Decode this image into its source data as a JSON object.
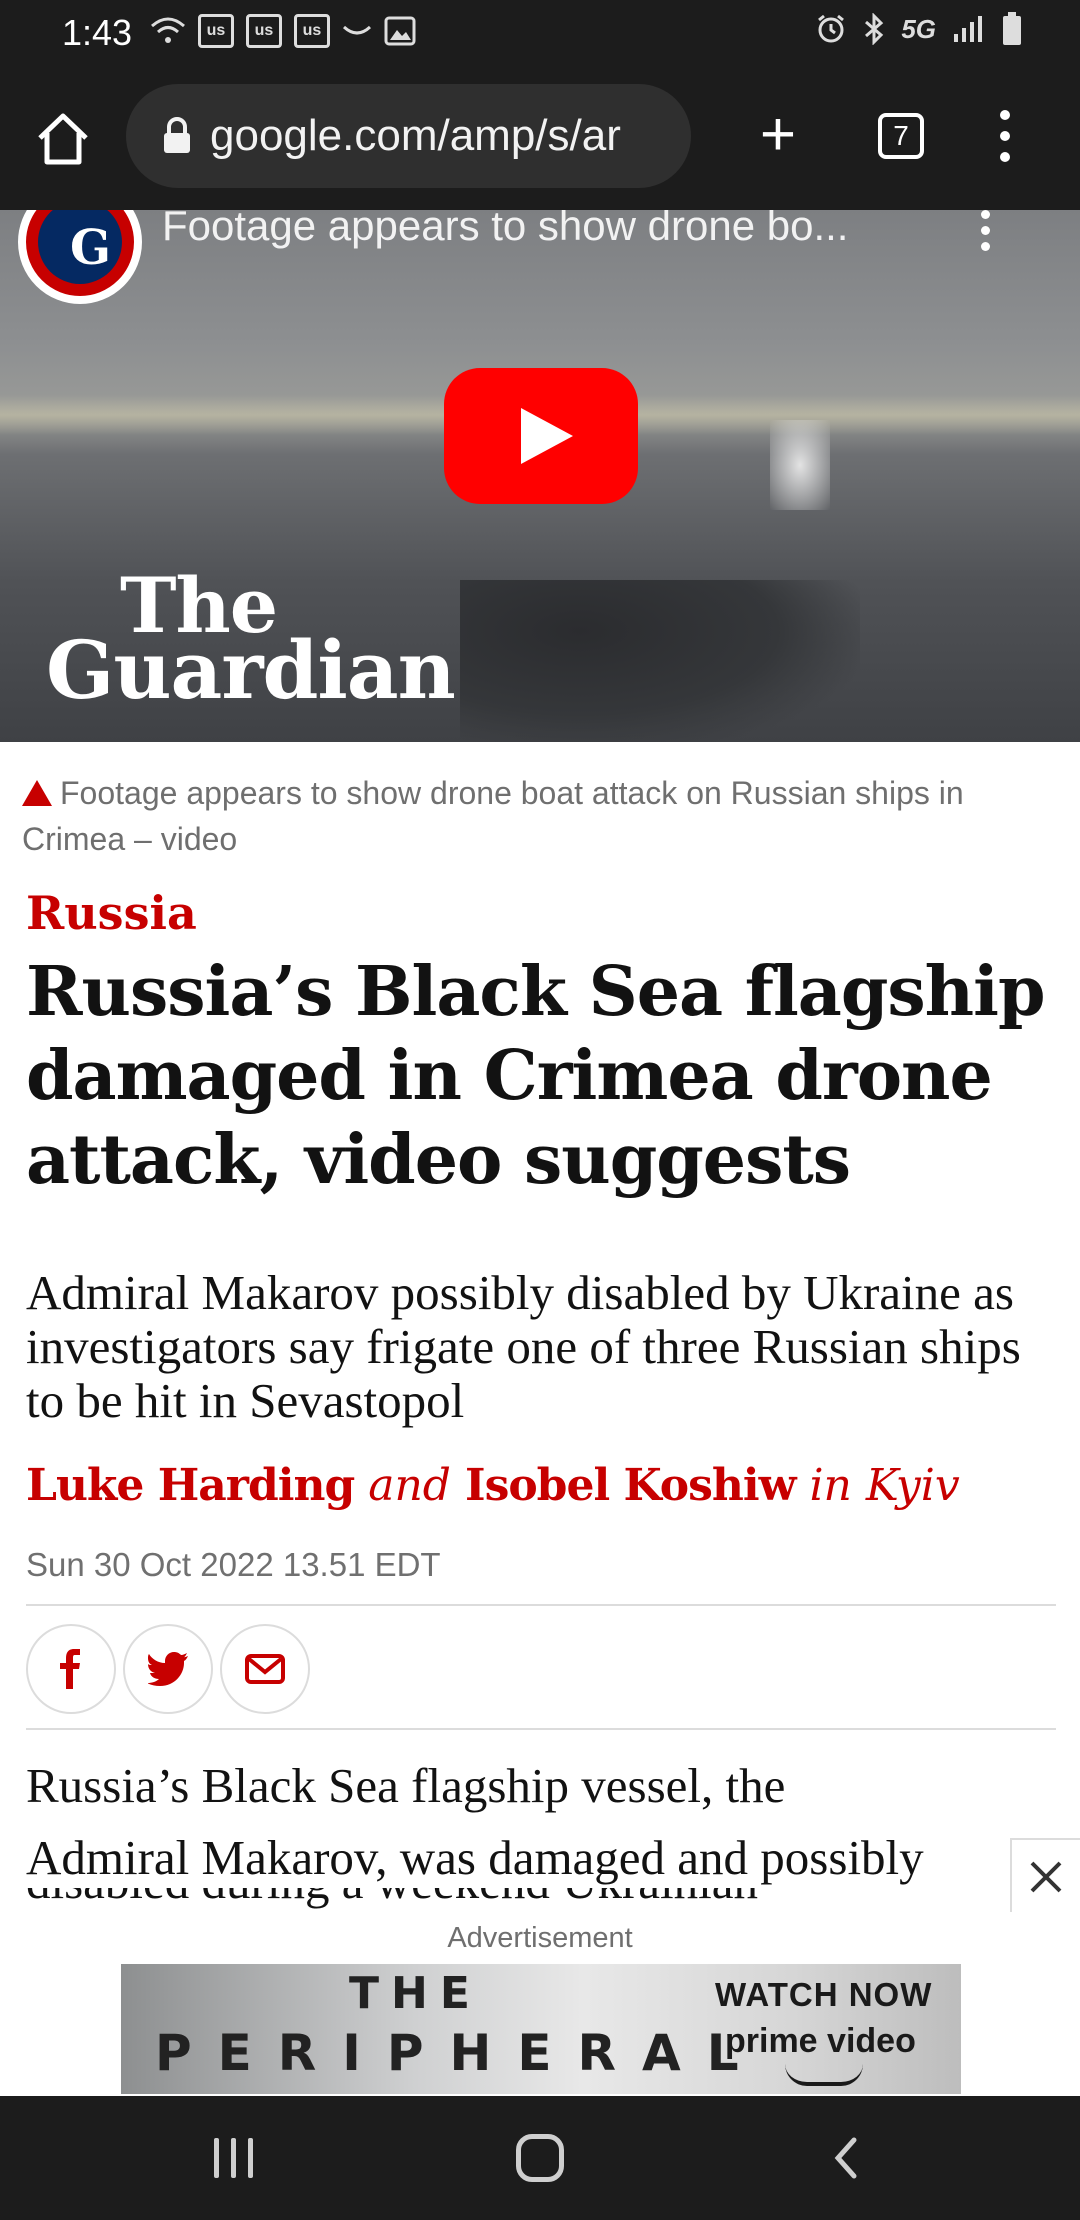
{
  "status_bar": {
    "time": "1:43",
    "box_icons": [
      "us",
      "us",
      "us"
    ],
    "network": "5G"
  },
  "browser": {
    "url": "google.com/amp/s/ar",
    "tab_count": "7"
  },
  "video": {
    "title": "Footage appears to show drone bo...",
    "wordmark_line1": "The",
    "wordmark_line2": "Guardian"
  },
  "article": {
    "caption": "Footage appears to show drone boat attack on Russian ships in Crimea – video",
    "kicker": "Russia",
    "headline": "Russia’s Black Sea flagship damaged in Crimea drone attack, video suggests",
    "standfirst": "Admiral Makarov possibly disabled by Ukraine as investigators say frigate one of three Russian ships to be hit in Sevastopol",
    "byline": {
      "author1": "Luke Harding",
      "conj": "and",
      "author2": "Isobel Koshiw",
      "location": "in Kyiv"
    },
    "date": "Sun 30 Oct 2022 13.51 EDT",
    "body_line1": "Russia’s Black Sea flagship vessel, the",
    "body_line2": "Admiral Makarov, was damaged and possibly",
    "body_line3_cut": "disabled during a weekend Ukrainian"
  },
  "ad": {
    "label": "Advertisement",
    "title_line1": "THE",
    "title_line2": "PERIPHERAL",
    "cta": "WATCH NOW",
    "brand": "prime video"
  },
  "colors": {
    "guardian_red": "#c70000",
    "guardian_navy": "#052962",
    "youtube_red": "#ff0000",
    "chrome_dark": "#1c1c1c"
  }
}
